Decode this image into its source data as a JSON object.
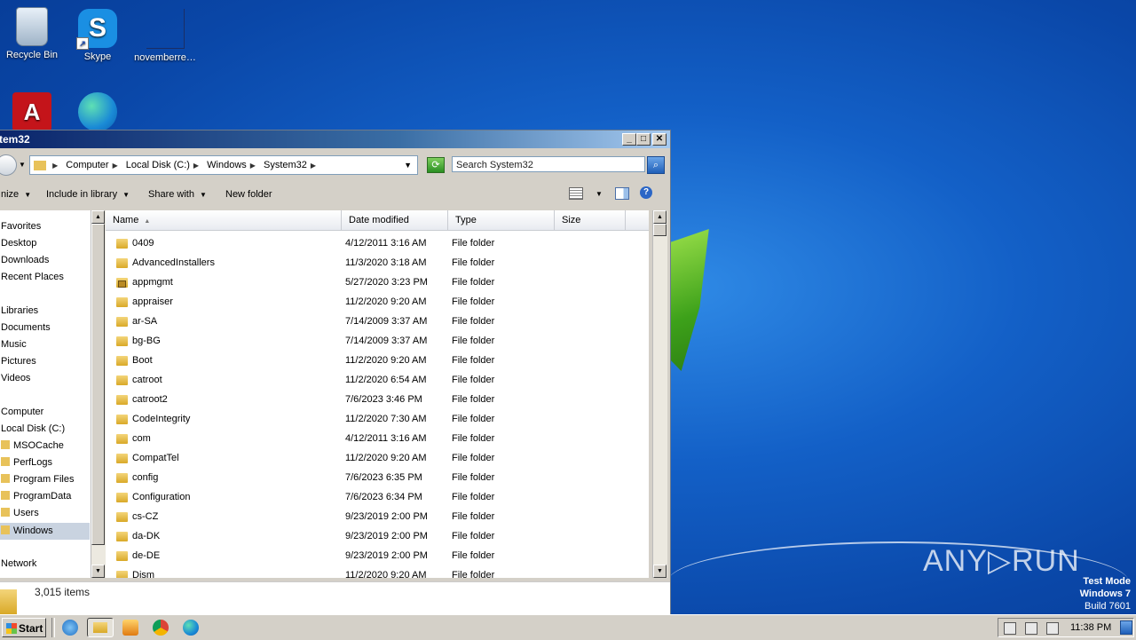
{
  "desktop": {
    "icons": [
      {
        "label": "Recycle Bin",
        "icon": "recycle-bin-icon"
      },
      {
        "label": "Skype",
        "icon": "skype-icon",
        "glyph": "S"
      },
      {
        "label": "novemberre…",
        "icon": "blank-file-icon"
      },
      {
        "label": "",
        "icon": "adobe-acrobat-icon",
        "glyph": "A"
      },
      {
        "label": "",
        "icon": "edge-icon"
      }
    ],
    "watermark": "ANY▷RUN",
    "os_badge": {
      "line1": "Test Mode",
      "line2": "Windows 7",
      "line3": "Build 7601"
    }
  },
  "window": {
    "title": "tem32",
    "controls": {
      "minimize": "_",
      "maximize": "□",
      "close": "✕"
    },
    "address": {
      "crumbs": [
        "Computer",
        "Local Disk (C:)",
        "Windows",
        "System32"
      ],
      "search_placeholder": "Search System32"
    },
    "toolbar": {
      "organize": "nize",
      "include": "Include in library",
      "share": "Share with",
      "new_folder": "New folder"
    },
    "nav": {
      "favorites": "Favorites",
      "desktop": "Desktop",
      "downloads": "Downloads",
      "recent": "Recent Places",
      "libraries": "Libraries",
      "documents": "Documents",
      "music": "Music",
      "pictures": "Pictures",
      "videos": "Videos",
      "computer": "Computer",
      "local_disk": "Local Disk (C:)",
      "folders": [
        "MSOCache",
        "PerfLogs",
        "Program Files",
        "ProgramData",
        "Users",
        "Windows"
      ],
      "network": "Network"
    },
    "columns": {
      "name": "Name",
      "date": "Date modified",
      "type": "Type",
      "size": "Size"
    },
    "files": [
      {
        "name": "0409",
        "date": "4/12/2011 3:16 AM",
        "type": "File folder"
      },
      {
        "name": "AdvancedInstallers",
        "date": "11/3/2020 3:18 AM",
        "type": "File folder"
      },
      {
        "name": "appmgmt",
        "date": "5/27/2020 3:23 PM",
        "type": "File folder",
        "locked": true
      },
      {
        "name": "appraiser",
        "date": "11/2/2020 9:20 AM",
        "type": "File folder"
      },
      {
        "name": "ar-SA",
        "date": "7/14/2009 3:37 AM",
        "type": "File folder"
      },
      {
        "name": "bg-BG",
        "date": "7/14/2009 3:37 AM",
        "type": "File folder"
      },
      {
        "name": "Boot",
        "date": "11/2/2020 9:20 AM",
        "type": "File folder"
      },
      {
        "name": "catroot",
        "date": "11/2/2020 6:54 AM",
        "type": "File folder"
      },
      {
        "name": "catroot2",
        "date": "7/6/2023 3:46 PM",
        "type": "File folder"
      },
      {
        "name": "CodeIntegrity",
        "date": "11/2/2020 7:30 AM",
        "type": "File folder"
      },
      {
        "name": "com",
        "date": "4/12/2011 3:16 AM",
        "type": "File folder"
      },
      {
        "name": "CompatTel",
        "date": "11/2/2020 9:20 AM",
        "type": "File folder"
      },
      {
        "name": "config",
        "date": "7/6/2023 6:35 PM",
        "type": "File folder"
      },
      {
        "name": "Configuration",
        "date": "7/6/2023 6:34 PM",
        "type": "File folder"
      },
      {
        "name": "cs-CZ",
        "date": "9/23/2019 2:00 PM",
        "type": "File folder"
      },
      {
        "name": "da-DK",
        "date": "9/23/2019 2:00 PM",
        "type": "File folder"
      },
      {
        "name": "de-DE",
        "date": "9/23/2019 2:00 PM",
        "type": "File folder"
      },
      {
        "name": "Dism",
        "date": "11/2/2020 9:20 AM",
        "type": "File folder"
      }
    ],
    "status": {
      "count": "3,015 items"
    }
  },
  "taskbar": {
    "start": "Start",
    "apps": [
      "internet-explorer-icon",
      "explorer-icon",
      "media-player-icon",
      "chrome-icon",
      "edge-icon"
    ],
    "clock": "11:38 PM"
  }
}
